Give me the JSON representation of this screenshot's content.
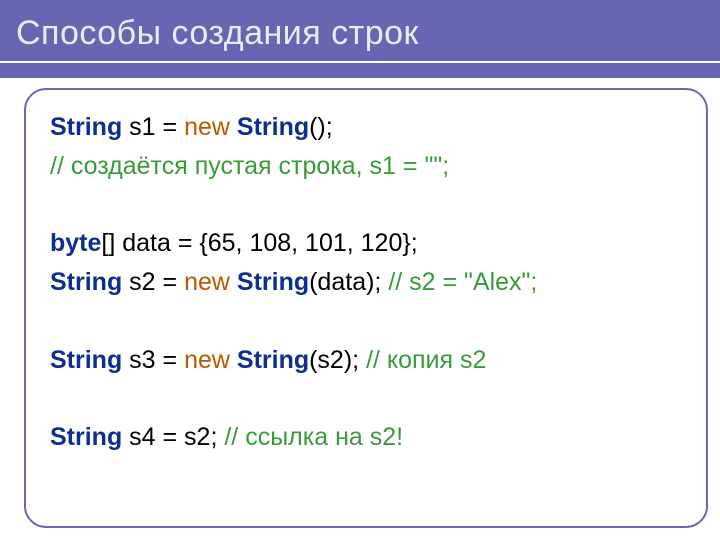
{
  "title": "Способы создания строк",
  "colors": {
    "band": "#6666b3",
    "keyword": "#0f2e8f",
    "new": "#b85a00",
    "comment": "#399a39"
  },
  "code": {
    "blank": " ",
    "l1": {
      "a": "String",
      "b": " s1 = ",
      "c": "new",
      "d": " ",
      "e": "String",
      "f": "();"
    },
    "l2": "// создаётся пустая строка, s1 = \"\";",
    "l3": {
      "a": "byte",
      "b": "[] data = {65, 108, 101, 120};"
    },
    "l4": {
      "a": "String",
      "b": " s2 = ",
      "c": "new",
      "d": " ",
      "e": "String",
      "f": "(data); ",
      "g": "// s2 = \"Alex\";"
    },
    "l5": {
      "a": "String",
      "b": " s3 = ",
      "c": "new",
      "d": " ",
      "e": "String",
      "f": "(s2); ",
      "g": "// копия s2"
    },
    "l6": {
      "a": "String",
      "b": " s4 = s2; ",
      "c": "// ссылка на s2!"
    }
  }
}
